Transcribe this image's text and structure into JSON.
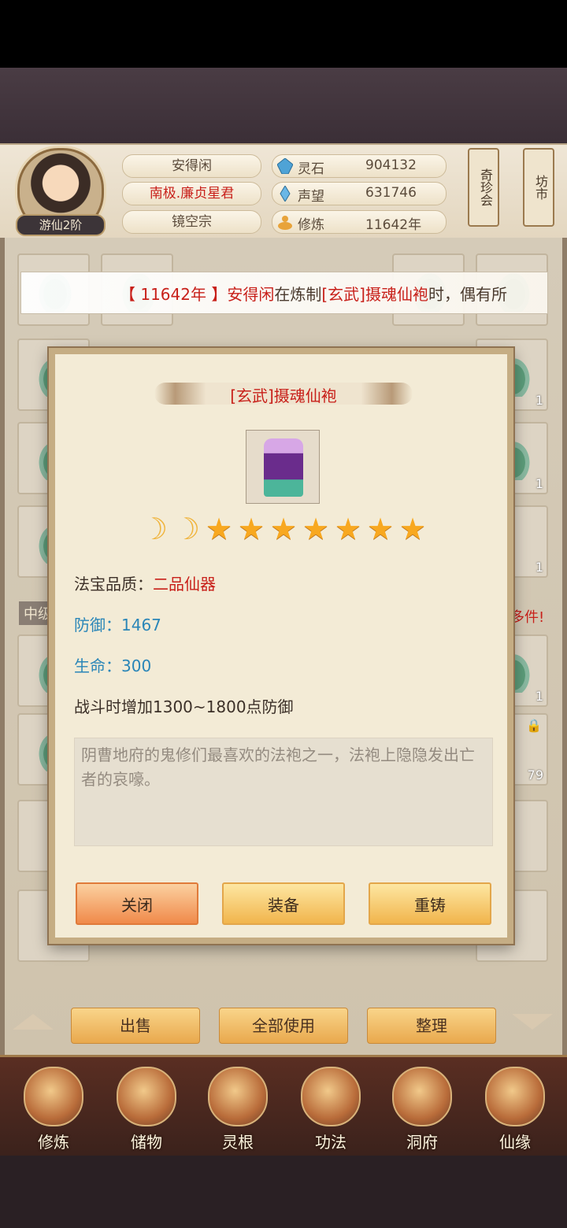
{
  "player": {
    "name": "安得闲",
    "title": "南极.廉贞星君",
    "sect": "镜空宗",
    "rank": "游仙2阶"
  },
  "stats": [
    {
      "icon": "spirit-stone-icon",
      "label": "灵石",
      "value": "904132"
    },
    {
      "icon": "reputation-icon",
      "label": "声望",
      "value": "631746"
    },
    {
      "icon": "cultivation-icon",
      "label": "修炼",
      "value": "11642年"
    }
  ],
  "side_buttons": {
    "treasure": "奇珍会",
    "market": "坊市"
  },
  "ticker": {
    "open": "【 ",
    "year": "11642年",
    "close": " 】",
    "name": "安得闲",
    "mid": "在炼制",
    "item": "[玄武]摄魂仙袍",
    "tail": "时，偶有所"
  },
  "side_text": {
    "left": "中级",
    "right": "多件!"
  },
  "slot_counts": [
    "1",
    "1",
    "1",
    "1",
    "1",
    "79"
  ],
  "modal": {
    "title": "[玄武]摄魂仙袍",
    "moons": 2,
    "stars": 7,
    "quality_label": "法宝品质：",
    "quality_value": "二品仙器",
    "defense": "防御：1467",
    "life": "生命：300",
    "effect": "战斗时增加1300~1800点防御",
    "description": "阴曹地府的鬼修们最喜欢的法袍之一，法袍上隐隐发出亡者的哀嚎。",
    "buttons": {
      "close": "关闭",
      "equip": "装备",
      "recast": "重铸"
    }
  },
  "actions": {
    "sell": "出售",
    "use_all": "全部使用",
    "sort": "整理"
  },
  "nav": [
    {
      "label": "修炼",
      "icon": "cultivation-nav-icon"
    },
    {
      "label": "储物",
      "icon": "storage-bag-icon"
    },
    {
      "label": "灵根",
      "icon": "spirit-root-icon"
    },
    {
      "label": "功法",
      "icon": "skill-book-icon"
    },
    {
      "label": "洞府",
      "icon": "cave-dwelling-icon"
    },
    {
      "label": "仙缘",
      "icon": "fate-icon"
    }
  ],
  "colors": {
    "accent_red": "#c8201a",
    "accent_blue": "#2a86b8",
    "button_orange": "#f08a4a",
    "button_gold": "#f1b54c"
  }
}
